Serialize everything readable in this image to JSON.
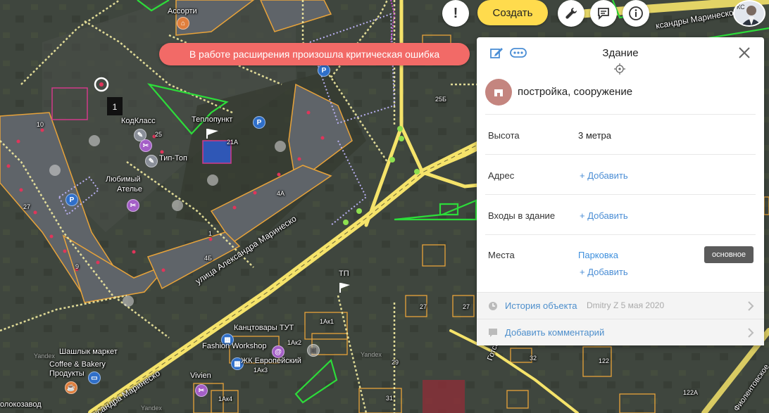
{
  "toolbar": {
    "create_label": "Создать",
    "alert_icon": "exclamation-icon",
    "tools_icon": "wrench-icon",
    "feedback_icon": "chat-icon",
    "info_icon": "info-icon",
    "avatar_text": "КС"
  },
  "error_message": "В работе расширения произошла критическая ошибка",
  "panel": {
    "title": "Здание",
    "type": "постройка, сооружение",
    "rows": {
      "height": {
        "label": "Высота",
        "value": "3 метра"
      },
      "address": {
        "label": "Адрес",
        "add": "+ Добавить"
      },
      "entrances": {
        "label": "Входы в здание",
        "add": "+ Добавить"
      },
      "places": {
        "label": "Места",
        "link": "Парковка",
        "badge": "основное",
        "add": "+ Добавить"
      }
    },
    "history": {
      "label": "История объекта",
      "meta": "Dmitry Z 5 мая 2020"
    },
    "comment": {
      "label": "Добавить комментарий"
    }
  },
  "map": {
    "labels": {
      "assorti": "Ассорти",
      "teplopunkt": "Теплопункт",
      "kodklass": "КодКласс",
      "tiptop": "Тип-Топ",
      "lyubimy": "Любимый",
      "atelie": "Ателье",
      "street1": "улица Александра Маринеско",
      "street2": "улица Александра Маринеско",
      "street3": "ксандра Маринеско",
      "street_top": "ксандры Маринеско",
      "kantstovary": "Канцтовары ТУТ",
      "fashion": "Fashion Workshop",
      "shashlyk": "Шашлык маркет",
      "coffee": "Coffee & Bakery",
      "produkty": "Продукты",
      "vivien": "Vivien",
      "zhk": "ЖК Европейский",
      "molokozavod": "олокозавод",
      "gotskaya": "Готская у",
      "filolent": "Фиолентовское",
      "tp": "ТП",
      "yandex1": "Yandex",
      "yandex2": "Yandex",
      "yandex3": "Yandex"
    },
    "house_numbers": {
      "n25": "25",
      "n21a": "21А",
      "n4a": "4А",
      "n4b": "4Б",
      "n27a": "27",
      "n25b": "25Б",
      "n27b": "27",
      "n27c": "27",
      "n1ak1": "1Ак1",
      "n1ak2": "1Ак2",
      "n1ak3": "1Ак3",
      "n1ak4": "1Ак4",
      "n29": "29",
      "n32": "32",
      "n122": "122",
      "n122a": "122А",
      "n31": "31",
      "n10": "10",
      "n9": "9",
      "n1": "1"
    },
    "selected_marker": "1"
  },
  "colors": {
    "accent_yellow": "#ffdb4d",
    "error_red": "#f26a67",
    "type_circle": "#c4857f",
    "link_blue": "#3d8fdd",
    "road_yellow": "#f5e36a",
    "building_outline": "#e8a33a",
    "green_zone": "#2ddc3a"
  }
}
